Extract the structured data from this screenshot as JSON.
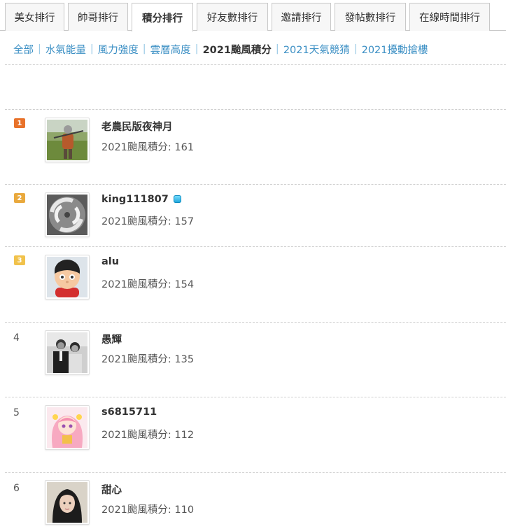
{
  "tabs": [
    {
      "label": "美女排行"
    },
    {
      "label": "帥哥排行"
    },
    {
      "label": "積分排行"
    },
    {
      "label": "好友數排行"
    },
    {
      "label": "邀請排行"
    },
    {
      "label": "發帖數排行"
    },
    {
      "label": "在線時間排行"
    }
  ],
  "active_tab": "積分排行",
  "subnav": [
    {
      "label": "全部"
    },
    {
      "label": "水氣能量"
    },
    {
      "label": "風力強度"
    },
    {
      "label": "雲層高度"
    },
    {
      "label": "2021颱風積分"
    },
    {
      "label": "2021天氣競猜"
    },
    {
      "label": "2021擾動搶樓"
    }
  ],
  "active_subnav": "2021颱風積分",
  "colors": {
    "link": "#3b8fc4",
    "rank1": "#e8722a",
    "rank2": "#e9a93d",
    "rank3": "#f1c24b"
  },
  "ranking": [
    {
      "rank": "1",
      "username": "老農民版夜神月",
      "score": "2021颱風積分: 161",
      "avatar": "farmer-photo"
    },
    {
      "rank": "2",
      "username": "king111807",
      "score": "2021颱風積分: 157",
      "avatar": "typhoon-satellite",
      "badge": "vip-icon"
    },
    {
      "rank": "3",
      "username": "alu",
      "score": "2021颱風積分: 154",
      "avatar": "cartoon-boy"
    },
    {
      "rank": "4",
      "username": "愚輝",
      "score": "2021颱風積分: 135",
      "avatar": "bw-couple-photo"
    },
    {
      "rank": "5",
      "username": "s6815711",
      "score": "2021颱風積分: 112",
      "avatar": "anime-girl"
    },
    {
      "rank": "6",
      "username": "甜心",
      "score": "2021颱風積分: 110",
      "avatar": "girl-photo"
    }
  ]
}
